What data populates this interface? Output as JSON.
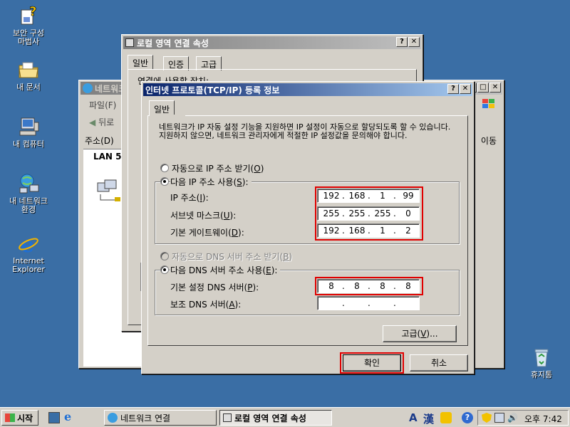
{
  "desktop": {
    "icons": [
      {
        "label": "보안 구성\n마법사",
        "icon": "security-wizard-icon"
      },
      {
        "label": "내 문서",
        "icon": "folder-icon"
      },
      {
        "label": "내 컴퓨터",
        "icon": "computer-icon"
      },
      {
        "label": "내 네트워크\n환경",
        "icon": "network-icon"
      },
      {
        "label": "Internet\nExplorer",
        "icon": "ie-icon"
      },
      {
        "label": "휴지통",
        "icon": "recycle-bin-icon"
      }
    ]
  },
  "network_window": {
    "title": "네트워크",
    "menu_file": "파일(F)",
    "back_label": "뒤로",
    "address_label": "주소(D)",
    "go_label": "이동",
    "lan_label": "LAN 5"
  },
  "lan_props": {
    "title": "로컬 영역 연결 속성",
    "tabs": [
      "일반",
      "인증",
      "고급"
    ],
    "connect_using": "연결에 사용할 장치:"
  },
  "tcpip": {
    "title": "인터넷 프로토콜(TCP/IP) 등록 정보",
    "tab": "일반",
    "description": "네트워크가 IP 자동 설정 기능을 지원하면 IP 설정이 자동으로 할당되도록 할 수 있습니다. 지원하지 않으면, 네트워크 관리자에게 적절한 IP 설정값을 문의해야 합니다.",
    "auto_ip": {
      "text": "자동으로 IP 주소 받기(",
      "key": "O",
      "end": ")"
    },
    "manual_ip": {
      "text": "다음 IP 주소 사용(",
      "key": "S",
      "end": "):"
    },
    "ip_label": {
      "text": "IP 주소(",
      "key": "I",
      "end": "):"
    },
    "subnet_label": {
      "text": "서브넷 마스크(",
      "key": "U",
      "end": "):"
    },
    "gateway_label": {
      "text": "기본 게이트웨이(",
      "key": "D",
      "end": "):"
    },
    "ip_address": [
      "192",
      "168",
      "1",
      "99"
    ],
    "subnet_mask": [
      "255",
      "255",
      "255",
      "0"
    ],
    "gateway": [
      "192",
      "168",
      "1",
      "2"
    ],
    "auto_dns": {
      "text": "자동으로 DNS 서버 주소 받기(",
      "key": "B",
      "end": ")"
    },
    "manual_dns": {
      "text": "다음 DNS 서버 주소 사용(",
      "key": "E",
      "end": "):"
    },
    "pref_dns_label": {
      "text": "기본 설정 DNS 서버(",
      "key": "P",
      "end": "):"
    },
    "alt_dns_label": {
      "text": "보조 DNS 서버(",
      "key": "A",
      "end": "):"
    },
    "preferred_dns": [
      "8",
      "8",
      "8",
      "8"
    ],
    "alternate_dns": [
      "",
      "",
      "",
      ""
    ],
    "advanced_button": {
      "text": "고급(",
      "key": "V",
      "end": ")..."
    },
    "ok_button": "확인",
    "cancel_button": "취소",
    "help_glyph": "?",
    "close_glyph": "✕"
  },
  "taskbar": {
    "start": "시작",
    "tasks": [
      "네트워크 연결",
      "로컬 영역 연결 속성"
    ],
    "ime_a": "A",
    "ime_han": "漢",
    "clock": "오후 7:42"
  },
  "colors": {
    "desktop": "#3a6ea5",
    "title_active": "#0a246a",
    "highlight_box": "#e00000"
  }
}
